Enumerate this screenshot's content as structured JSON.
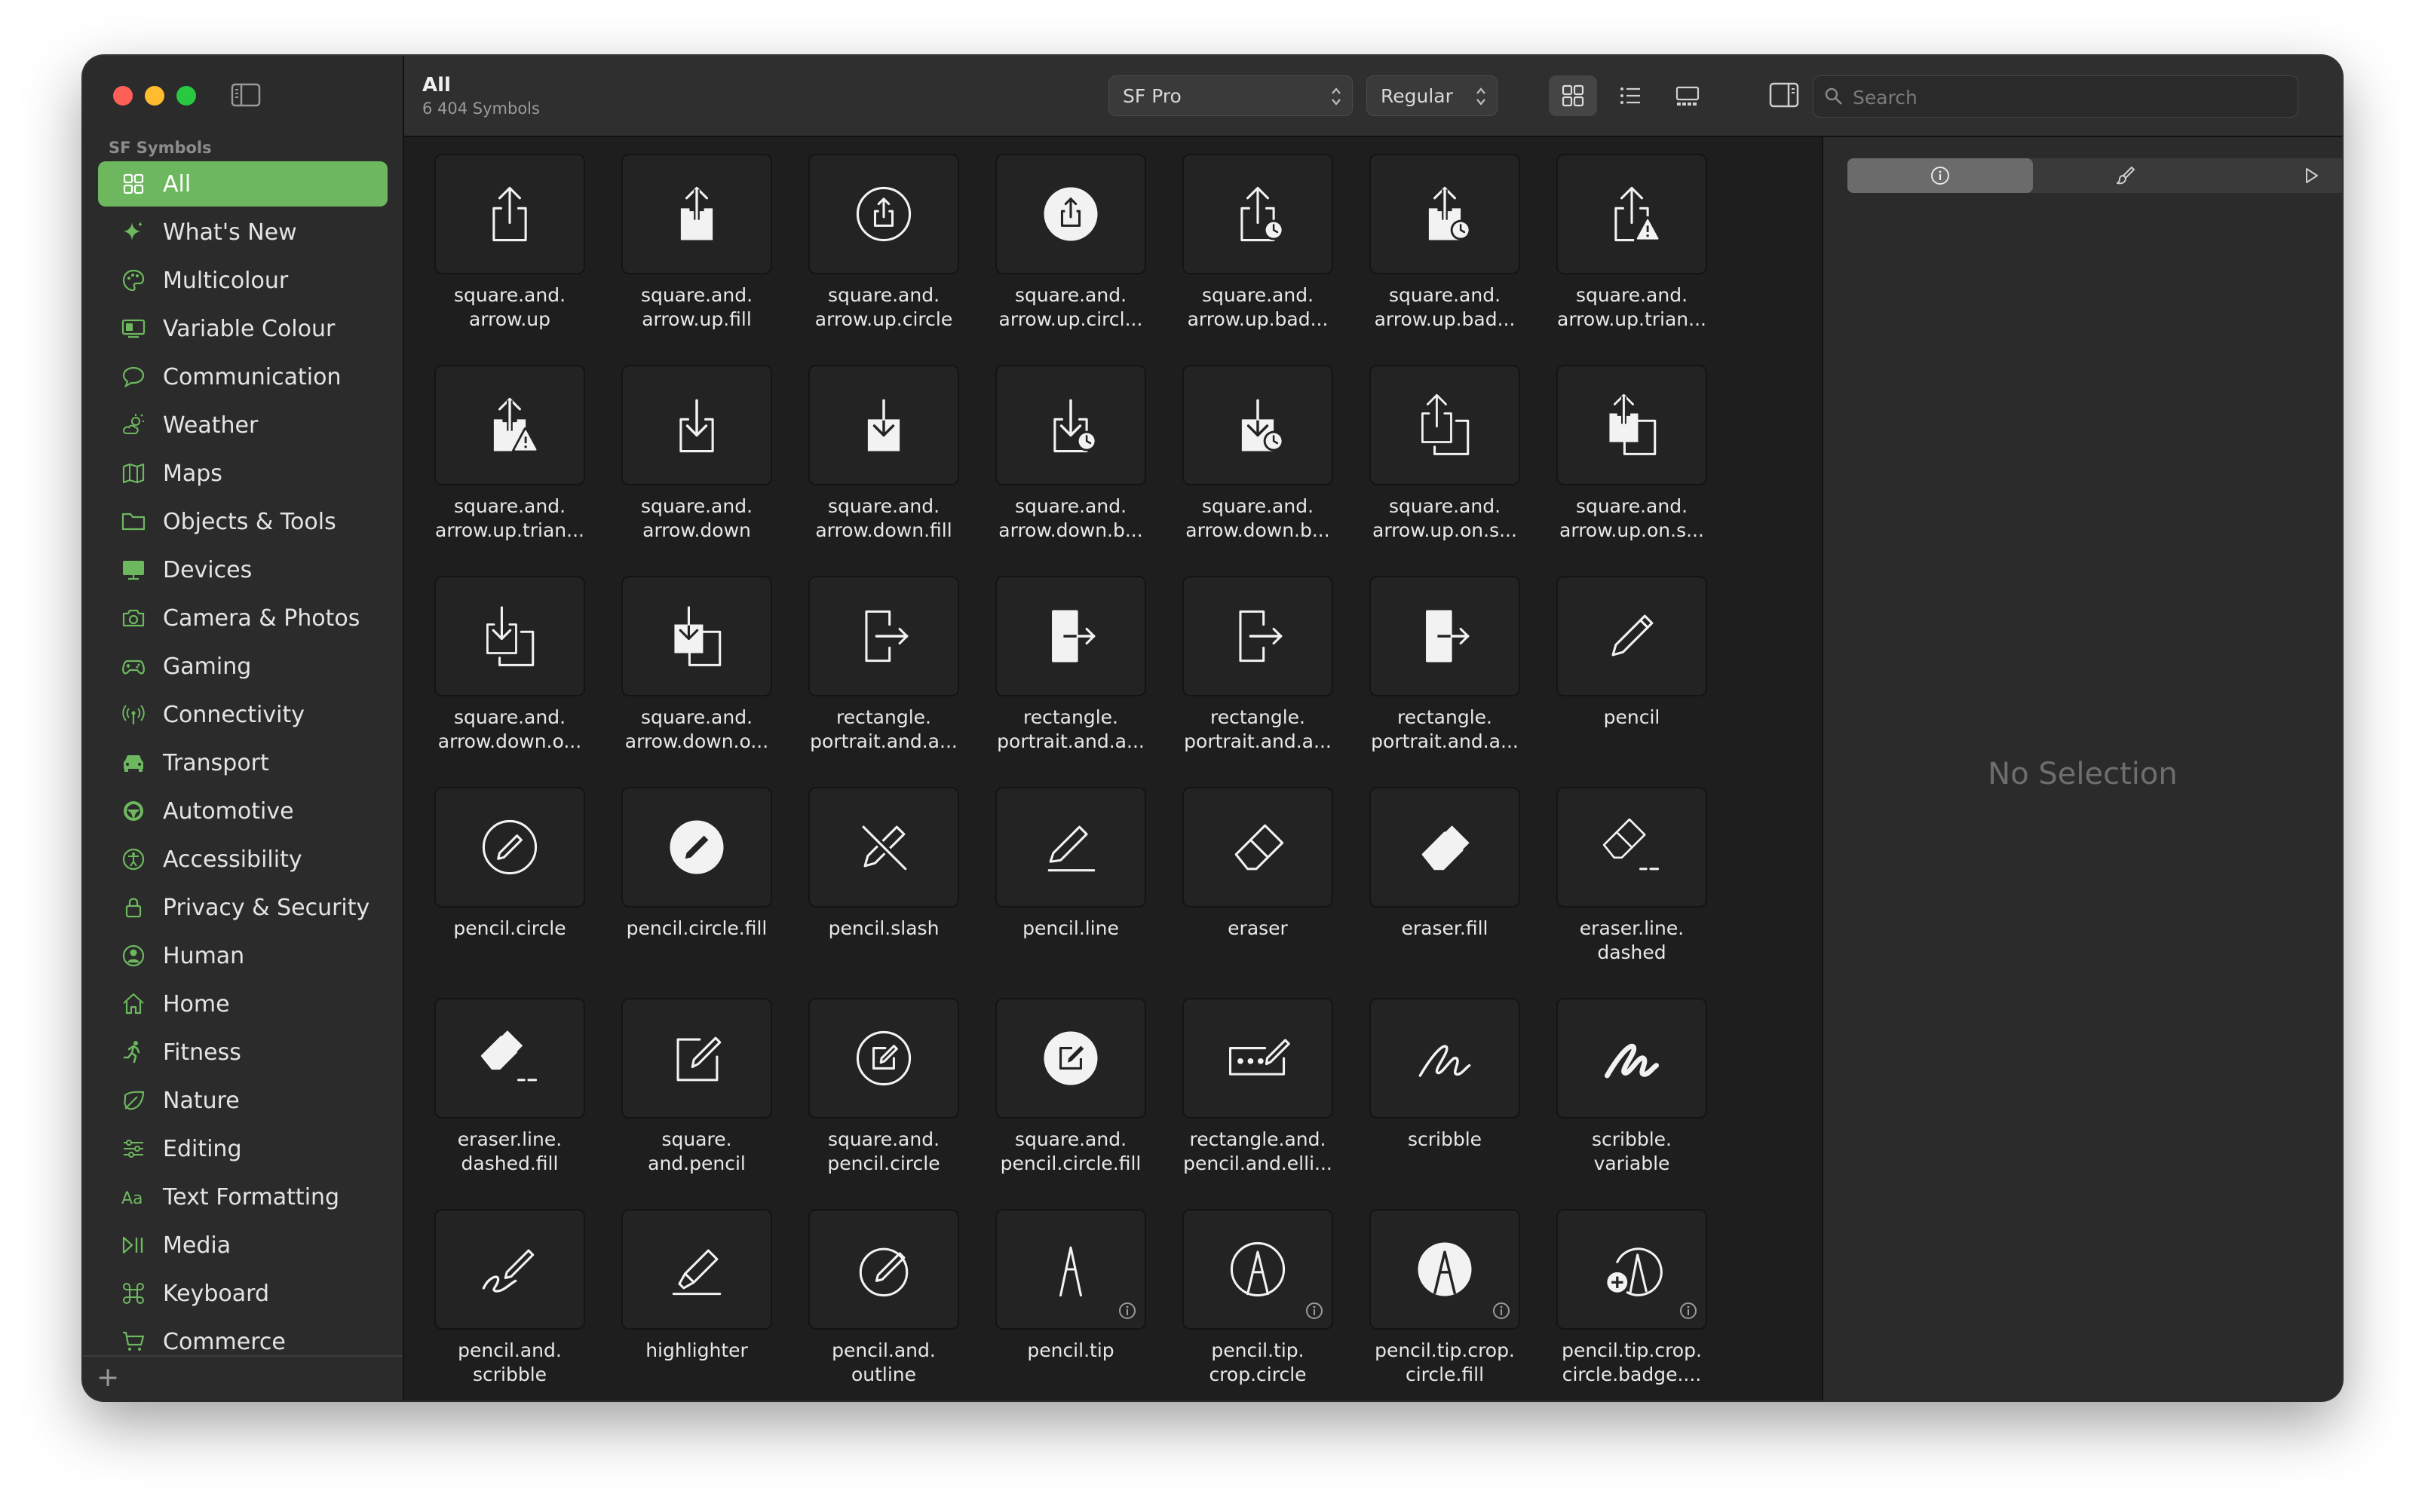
{
  "window": {
    "accent": "#6db85e"
  },
  "sidebar": {
    "section_title": "SF Symbols",
    "items": [
      {
        "label": "All",
        "icon": "grid-icon",
        "active": true
      },
      {
        "label": "What's New",
        "icon": "sparkle-icon"
      },
      {
        "label": "Multicolour",
        "icon": "palette-icon"
      },
      {
        "label": "Variable Colour",
        "icon": "variable-colour-icon"
      },
      {
        "label": "Communication",
        "icon": "speech-bubble-icon"
      },
      {
        "label": "Weather",
        "icon": "cloud-sun-icon"
      },
      {
        "label": "Maps",
        "icon": "map-icon"
      },
      {
        "label": "Objects & Tools",
        "icon": "folder-icon"
      },
      {
        "label": "Devices",
        "icon": "display-icon"
      },
      {
        "label": "Camera & Photos",
        "icon": "camera-icon"
      },
      {
        "label": "Gaming",
        "icon": "gamecontroller-icon"
      },
      {
        "label": "Connectivity",
        "icon": "antenna-icon"
      },
      {
        "label": "Transport",
        "icon": "car-icon"
      },
      {
        "label": "Automotive",
        "icon": "steering-wheel-icon"
      },
      {
        "label": "Accessibility",
        "icon": "accessibility-icon"
      },
      {
        "label": "Privacy & Security",
        "icon": "lock-icon"
      },
      {
        "label": "Human",
        "icon": "person-icon"
      },
      {
        "label": "Home",
        "icon": "house-icon"
      },
      {
        "label": "Fitness",
        "icon": "figure-run-icon"
      },
      {
        "label": "Nature",
        "icon": "leaf-icon"
      },
      {
        "label": "Editing",
        "icon": "sliders-icon"
      },
      {
        "label": "Text Formatting",
        "icon": "textformat-icon"
      },
      {
        "label": "Media",
        "icon": "play-pause-icon"
      },
      {
        "label": "Keyboard",
        "icon": "command-icon"
      },
      {
        "label": "Commerce",
        "icon": "cart-icon"
      }
    ],
    "add_label": "+"
  },
  "toolbar": {
    "title": "All",
    "subtitle": "6 404 Symbols",
    "font_popup": "SF Pro",
    "weight_popup": "Regular",
    "search_placeholder": "Search",
    "search_value": ""
  },
  "symbols": [
    {
      "label": "square.and.\narrow.up",
      "icon": "share-icon"
    },
    {
      "label": "square.and.\narrow.up.fill",
      "icon": "share-fill-icon"
    },
    {
      "label": "square.and.\narrow.up.circle",
      "icon": "share-circle-icon"
    },
    {
      "label": "square.and.\narrow.up.circl...",
      "icon": "share-circle-fill-icon"
    },
    {
      "label": "square.and.\narrow.up.bad...",
      "icon": "share-badge-clock-icon"
    },
    {
      "label": "square.and.\narrow.up.bad...",
      "icon": "share-fill-badge-clock-icon"
    },
    {
      "label": "square.and.\narrow.up.trian...",
      "icon": "share-warning-icon"
    },
    {
      "label": "square.and.\narrow.up.trian...",
      "icon": "share-fill-warning-icon"
    },
    {
      "label": "square.and.\narrow.down",
      "icon": "download-icon"
    },
    {
      "label": "square.and.\narrow.down.fill",
      "icon": "download-fill-icon"
    },
    {
      "label": "square.and.\narrow.down.b...",
      "icon": "download-badge-clock-icon"
    },
    {
      "label": "square.and.\narrow.down.b...",
      "icon": "download-fill-badge-clock-icon"
    },
    {
      "label": "square.and.\narrow.up.on.s...",
      "icon": "share-on-square-icon"
    },
    {
      "label": "square.and.\narrow.up.on.s...",
      "icon": "share-on-square-fill-icon"
    },
    {
      "label": "square.and.\narrow.down.o...",
      "icon": "download-on-square-icon"
    },
    {
      "label": "square.and.\narrow.down.o...",
      "icon": "download-on-square-fill-icon"
    },
    {
      "label": "rectangle.\nportrait.and.a...",
      "icon": "portrait-arrow-icon"
    },
    {
      "label": "rectangle.\nportrait.and.a...",
      "icon": "portrait-arrow-fill-icon"
    },
    {
      "label": "rectangle.\nportrait.and.a...",
      "icon": "portrait-arrow-icon"
    },
    {
      "label": "rectangle.\nportrait.and.a...",
      "icon": "portrait-arrow-fill-icon"
    },
    {
      "label": "pencil",
      "icon": "pencil-icon"
    },
    {
      "label": "pencil.circle",
      "icon": "pencil-circle-icon"
    },
    {
      "label": "pencil.circle.fill",
      "icon": "pencil-circle-fill-icon"
    },
    {
      "label": "pencil.slash",
      "icon": "pencil-slash-icon"
    },
    {
      "label": "pencil.line",
      "icon": "pencil-line-icon"
    },
    {
      "label": "eraser",
      "icon": "eraser-icon"
    },
    {
      "label": "eraser.fill",
      "icon": "eraser-fill-icon"
    },
    {
      "label": "eraser.line.\ndashed",
      "icon": "eraser-dashed-icon"
    },
    {
      "label": "eraser.line.\ndashed.fill",
      "icon": "eraser-dashed-fill-icon"
    },
    {
      "label": "square.\nand.pencil",
      "icon": "square-pencil-icon"
    },
    {
      "label": "square.and.\npencil.circle",
      "icon": "square-pencil-circle-icon"
    },
    {
      "label": "square.and.\npencil.circle.fill",
      "icon": "square-pencil-circle-fill-icon"
    },
    {
      "label": "rectangle.and.\npencil.and.elli...",
      "icon": "rect-pencil-ellipsis-icon"
    },
    {
      "label": "scribble",
      "icon": "scribble-icon"
    },
    {
      "label": "scribble.\nvariable",
      "icon": "scribble-variable-icon"
    },
    {
      "label": "pencil.and.\nscribble",
      "icon": "pencil-scribble-icon"
    },
    {
      "label": "highlighter",
      "icon": "highlighter-icon"
    },
    {
      "label": "pencil.and.\noutline",
      "icon": "pencil-outline-icon"
    },
    {
      "label": "pencil.tip",
      "icon": "pencil-tip-icon",
      "info": true
    },
    {
      "label": "pencil.tip.\ncrop.circle",
      "icon": "pencil-tip-circle-icon",
      "info": true
    },
    {
      "label": "pencil.tip.crop.\ncircle.fill",
      "icon": "pencil-tip-circle-fill-icon",
      "info": true
    },
    {
      "label": "pencil.tip.crop.\ncircle.badge....",
      "icon": "pencil-tip-badge-plus-icon",
      "info": true
    }
  ],
  "inspector": {
    "tabs": [
      {
        "name": "info-tab",
        "icon": "info-icon",
        "selected": true
      },
      {
        "name": "paintbrush-tab",
        "icon": "paintbrush-icon"
      },
      {
        "name": "play-tab",
        "icon": "play-icon"
      }
    ],
    "empty_text": "No Selection"
  }
}
